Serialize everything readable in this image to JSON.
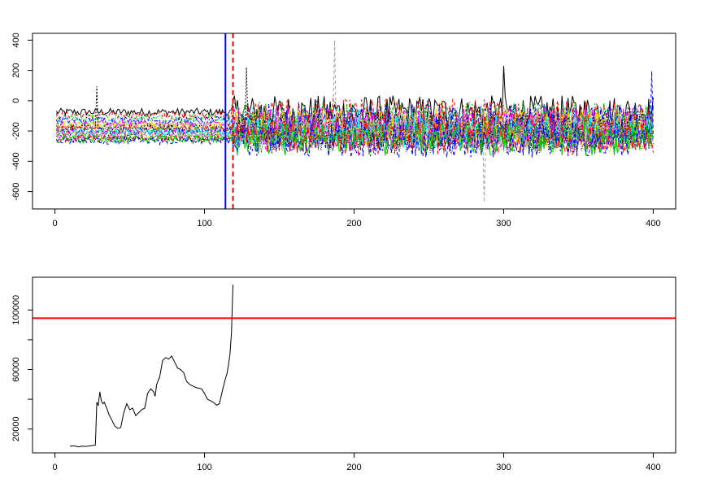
{
  "chart_data": [
    {
      "type": "line",
      "title": "",
      "xlabel": "",
      "ylabel": "",
      "xlim": [
        -15,
        415
      ],
      "ylim": [
        -715,
        445
      ],
      "grid": false,
      "legend": "none",
      "x_ticks": [
        0,
        100,
        200,
        300,
        400
      ],
      "y_ticks": [
        -600,
        -400,
        -200,
        0,
        200,
        400
      ],
      "x_tick_labels": [
        "0",
        "100",
        "200",
        "300",
        "400"
      ],
      "y_tick_labels": [
        "-600",
        "-400",
        "-200",
        "0",
        "200",
        "400"
      ],
      "series_count": 20,
      "series_colors": [
        "#000000",
        "#ff0000",
        "#00cd00",
        "#0000ff",
        "#00ffff",
        "#ff00ff",
        "#ffd700",
        "#a0a0a0"
      ],
      "series_levels": [
        -75,
        -95,
        -115,
        -130,
        -145,
        -155,
        -165,
        -172,
        -180,
        -188,
        -195,
        -202,
        -210,
        -218,
        -225,
        -232,
        -240,
        -248,
        -255,
        -265
      ],
      "x_range": [
        1,
        400
      ],
      "phase1_end": 118,
      "approx_amplitude_phase1": 25,
      "approx_amplitude_phase2": 110,
      "spikes": [
        {
          "x": 28,
          "y": 95
        },
        {
          "x": 128,
          "y": 220
        },
        {
          "x": 187,
          "y": 400
        },
        {
          "x": 287,
          "y": -670
        },
        {
          "x": 300,
          "y": 230
        },
        {
          "x": 399,
          "y": 195
        }
      ],
      "vlines": [
        {
          "x": 114,
          "color": "#0000ff",
          "style": "solid"
        },
        {
          "x": 119,
          "color": "#ff0000",
          "style": "dashed"
        }
      ]
    },
    {
      "type": "line",
      "title": "",
      "xlabel": "",
      "ylabel": "",
      "xlim": [
        -15,
        415
      ],
      "ylim": [
        4000,
        122000
      ],
      "grid": false,
      "legend": "none",
      "x_ticks": [
        0,
        100,
        200,
        300,
        400
      ],
      "y_ticks": [
        20000,
        60000,
        100000
      ],
      "y_minor_ticks": [
        40000,
        80000
      ],
      "x_tick_labels": [
        "0",
        "100",
        "200",
        "300",
        "400"
      ],
      "y_tick_labels": [
        "20000",
        "60000",
        "100000"
      ],
      "hline": {
        "y": 94500,
        "color": "#ff0000"
      },
      "series": [
        {
          "x": [
            10,
            13,
            16,
            18,
            20,
            22,
            24,
            26,
            27,
            28,
            29,
            30,
            31,
            32,
            33,
            35,
            36,
            38,
            40,
            42,
            44,
            46,
            48,
            50,
            52,
            54,
            56,
            58,
            60,
            62,
            64,
            66,
            67,
            68,
            70,
            72,
            74,
            76,
            78,
            80,
            82,
            84,
            86,
            88,
            90,
            92,
            94,
            96,
            98,
            100,
            102,
            104,
            106,
            108,
            110,
            112,
            113,
            114,
            115,
            116,
            117,
            118,
            119
          ],
          "y": [
            8500,
            8700,
            8000,
            8600,
            8300,
            8500,
            8800,
            9000,
            9200,
            38000,
            36000,
            45000,
            39000,
            37000,
            38000,
            33000,
            30000,
            26000,
            22000,
            20500,
            21000,
            31000,
            37000,
            33000,
            34000,
            29000,
            31000,
            33000,
            34000,
            44000,
            47000,
            45000,
            42000,
            50000,
            55000,
            66000,
            68000,
            67000,
            69000,
            65000,
            61000,
            60000,
            58000,
            52000,
            50000,
            49000,
            48000,
            47500,
            47000,
            44000,
            40000,
            39000,
            38000,
            36000,
            37000,
            46000,
            50000,
            54000,
            57000,
            63000,
            70000,
            85000,
            117000
          ]
        }
      ]
    }
  ]
}
